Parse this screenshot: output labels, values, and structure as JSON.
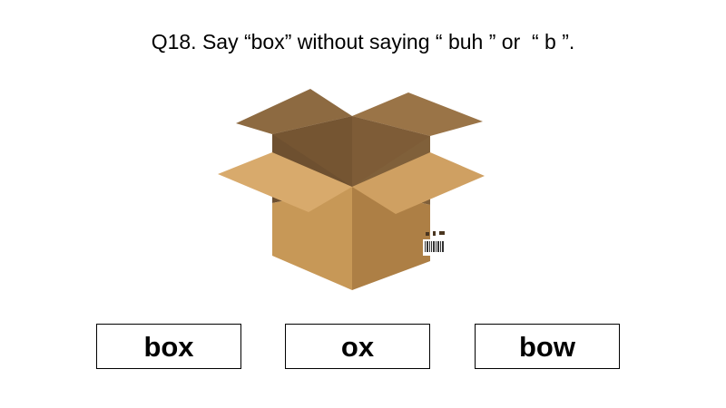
{
  "question": {
    "text": "Q18. Say “box” without saying “ buh ” or  “ b ”."
  },
  "illustration": {
    "icon": "cardboard-box-icon",
    "colors": {
      "flap_light": "#d6a86b",
      "flap_mid": "#a87f4d",
      "interior_dark": "#7a5a36",
      "front": "#c99a5f",
      "side": "#b48548"
    }
  },
  "answers": [
    {
      "label": "box"
    },
    {
      "label": "ox"
    },
    {
      "label": "bow"
    }
  ]
}
